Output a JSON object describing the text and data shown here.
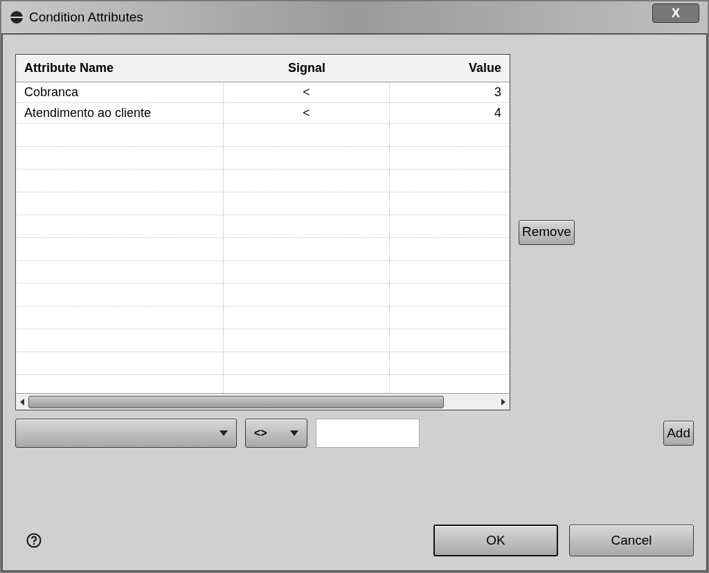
{
  "window": {
    "title": "Condition Attributes",
    "close": "X"
  },
  "table": {
    "columns": [
      "Attribute Name",
      "Signal",
      "Value"
    ],
    "rows": [
      [
        "Cobranca",
        "<",
        "3"
      ],
      [
        "Atendimento ao cliente",
        "<",
        "4"
      ]
    ]
  },
  "remove_button": "Remove",
  "signal_combo": {
    "value": "<>"
  },
  "add_button": "Add",
  "buttons": [
    "OK",
    "Cancel"
  ]
}
